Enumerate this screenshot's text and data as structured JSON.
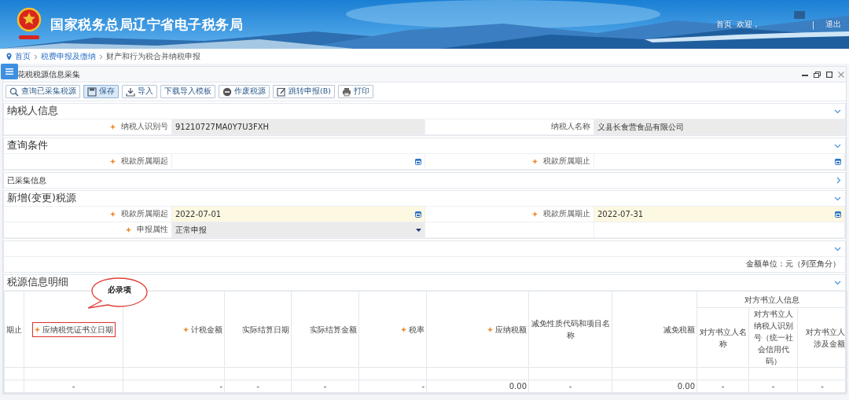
{
  "header": {
    "title": "国家税务总局辽宁省电子税务局",
    "links": [
      {
        "kind": "link",
        "text": "首页"
      },
      {
        "kind": "text",
        "text": "欢迎，"
      },
      {
        "kind": "sep",
        "text": "|"
      },
      {
        "kind": "link",
        "text": "退出"
      }
    ]
  },
  "breadcrumb": [
    "首页",
    "税费申报及缴纳",
    "财产和行为税合并纳税申报"
  ],
  "panel": {
    "title": "花税税源信息采集"
  },
  "toolbar": [
    {
      "kind": "search",
      "label": "查询已采集税源"
    },
    {
      "kind": "save",
      "label": "保存",
      "selected": true
    },
    {
      "kind": "import",
      "label": "导入"
    },
    {
      "kind": "plain",
      "label": "下载导入模板"
    },
    {
      "kind": "void",
      "label": "作废税源"
    },
    {
      "kind": "edit",
      "label": "跳转申报(B)"
    },
    {
      "kind": "print",
      "label": "打印"
    }
  ],
  "sections": [
    {
      "kind": "form",
      "title": "纳税人信息",
      "expanded": true,
      "rows": [
        [
          {
            "label": "纳税人识别号",
            "required": true,
            "value": "91210727MA0Y7U3FXH",
            "kind": "readonly"
          },
          {
            "label": "纳税人名称",
            "required": false,
            "value": "义县长食营食品有限公司",
            "kind": "readonly"
          }
        ]
      ]
    },
    {
      "kind": "form",
      "title": "查询条件",
      "expanded": true,
      "rows": [
        [
          {
            "label": "税款所属期起",
            "required": true,
            "kind": "date",
            "highlighted": false
          },
          {
            "label": "税款所属期止",
            "required": true,
            "kind": "date",
            "highlighted": false
          }
        ]
      ]
    },
    {
      "kind": "list",
      "title": "已采集信息",
      "expanded": false
    },
    {
      "kind": "form",
      "title": "新增(变更)税源",
      "expanded": true,
      "rows": [
        [
          {
            "label": "税款所属期起",
            "required": true,
            "value": "2022-07-01",
            "kind": "date",
            "highlighted": true
          },
          {
            "label": "税款所属期止",
            "required": true,
            "value": "2022-07-31",
            "kind": "date",
            "highlighted": true
          }
        ],
        [
          {
            "label": "申报属性",
            "required": true,
            "value": "正常申报",
            "kind": "select"
          }
        ]
      ]
    },
    {
      "kind": "note",
      "expanded": true,
      "note": "金额单位：元（列至角分）"
    },
    {
      "kind": "table",
      "title": "税源信息明细",
      "expanded": true,
      "callout": "必录项",
      "columns": [
        {
          "label": "期止",
          "required": false
        },
        {
          "label": "应纳税凭证书立日期",
          "required": true,
          "highlighted": true
        },
        {
          "label": "计税金额",
          "required": true
        },
        {
          "label": "实际结算日期",
          "required": false
        },
        {
          "label": "实际结算金额",
          "required": false
        },
        {
          "label": "税率",
          "required": true
        },
        {
          "label": "应纳税额",
          "required": true
        },
        {
          "label": "减免性质代码和项目名称",
          "required": false
        },
        {
          "label": "减免税额",
          "required": false
        },
        {
          "kind": "group",
          "label": "对方书立人信息",
          "columns": [
            {
              "label": "对方书立人名称",
              "required": false
            },
            {
              "label": "对方书立人纳税人识别号（统一社会信用代码）",
              "required": false
            },
            {
              "label": "对方书立人涉及金额",
              "required": false
            }
          ]
        }
      ],
      "rows": [
        {
          "kind": "empty"
        },
        {
          "kind": "data",
          "cells": [
            null,
            "-",
            "-",
            "-",
            "-",
            "-",
            "0.00",
            "-",
            "0.00",
            "-",
            "-",
            "-"
          ]
        }
      ]
    }
  ]
}
